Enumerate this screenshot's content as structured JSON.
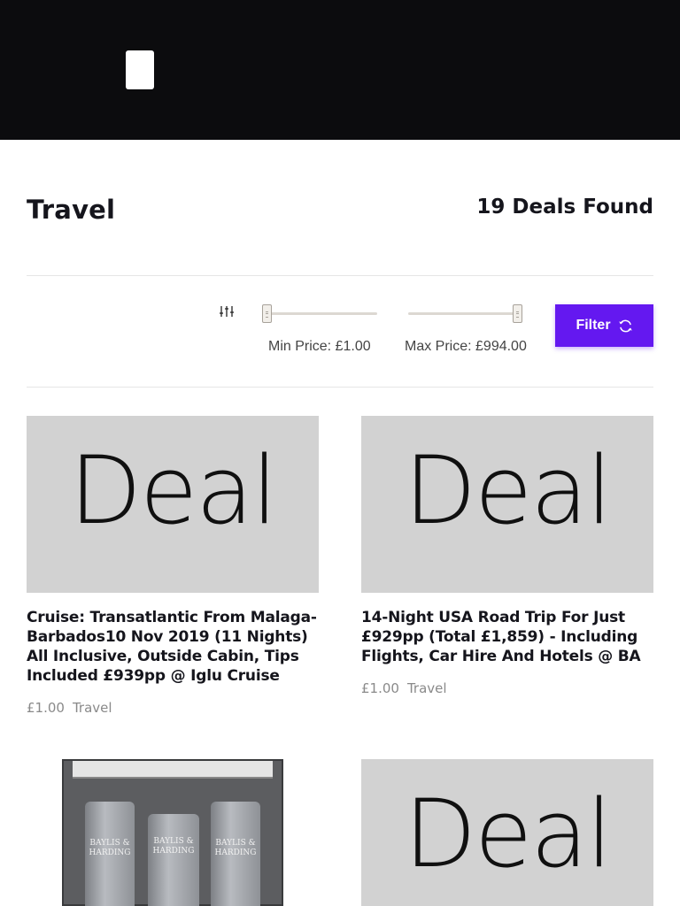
{
  "page": {
    "title": "Travel",
    "deals_found": "19 Deals Found"
  },
  "filter": {
    "min_price_label": "Min Price: £1.00",
    "max_price_label": "Max Price: £994.00",
    "button_label": "Filter",
    "min_value": 1.0,
    "max_value": 994.0
  },
  "deals": [
    {
      "image_text": "Deal",
      "title": "Cruise: Transatlantic From Malaga-Barbados10 Nov 2019 (11 Nights) All Inclusive, Outside Cabin, Tips Included £939pp @ Iglu Cruise",
      "price": "£1.00",
      "category": "Travel"
    },
    {
      "image_text": "Deal",
      "title": "14-Night USA Road Trip For Just £929pp (Total £1,859) - Including Flights, Car Hire And Hotels @ BA",
      "price": "£1.00",
      "category": "Travel"
    },
    {
      "image_brand": "BAYLIS & HARDING"
    },
    {
      "image_text": "Deal"
    }
  ]
}
